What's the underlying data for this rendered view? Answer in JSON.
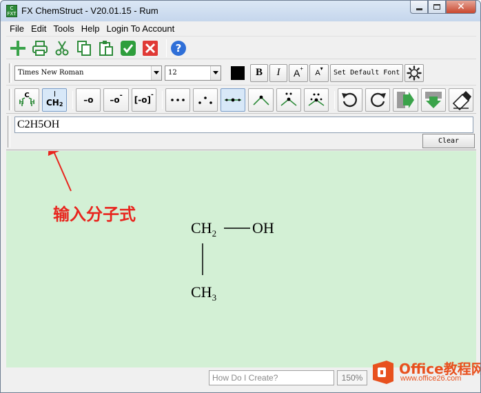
{
  "window": {
    "title": "FX ChemStruct - V20.01.15 - Rum",
    "app_icon_text": "C FXT"
  },
  "menu": [
    "File",
    "Edit",
    "Tools",
    "Help",
    "Login To Account"
  ],
  "toolbar_main": {
    "icons": [
      "add-icon",
      "print-icon",
      "cut-icon",
      "copy-icon",
      "paste-icon",
      "confirm-icon",
      "cancel-icon",
      "help-icon"
    ]
  },
  "toolbar_font": {
    "font_name": "Times New Roman",
    "font_size": "12",
    "color": "#000000",
    "bold_label": "B",
    "italic_label": "I",
    "superscript_label": "A",
    "subscript_label": "A",
    "set_default_font_label": "Set Default Font"
  },
  "toolbar_chem": {
    "structure_label": "C",
    "ch2_label": "CH",
    "ch2_sub": "2",
    "bond_o_label": "–o",
    "bond_o_minus_label": "–o",
    "bracket_o_label": "[-o]"
  },
  "formula": {
    "value": "C2H5OH",
    "clear_label": "Clear"
  },
  "canvas": {
    "annotation": "输入分子式",
    "molecule": {
      "ch2": "CH",
      "ch2_sub": "2",
      "oh": "OH",
      "ch3": "CH",
      "ch3_sub": "3"
    }
  },
  "status": {
    "help_placeholder": "How Do I Create?",
    "zoom": "150%"
  },
  "watermark": {
    "brand": "Office教程网",
    "url": "www.office26.com"
  },
  "colors": {
    "canvas_bg": "#d3f0d5",
    "annotation": "#e8251e",
    "watermark": "#e8511e"
  }
}
